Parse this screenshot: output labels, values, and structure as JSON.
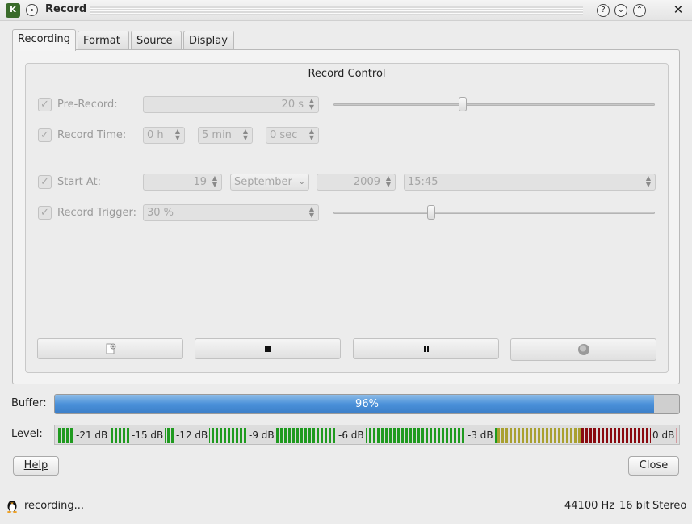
{
  "window": {
    "title": "Record",
    "app_icon": "kwave-icon"
  },
  "tabs": [
    {
      "label": "Recording",
      "mnemonic": "R"
    },
    {
      "label": "Format",
      "mnemonic": "m"
    },
    {
      "label": "Source",
      "mnemonic": "S"
    },
    {
      "label": "Display",
      "mnemonic": "D"
    }
  ],
  "record_control": {
    "title": "Record Control",
    "pre_record": {
      "label": "Pre-Record:",
      "value": "20 s",
      "slider_fraction": 0.4
    },
    "record_time": {
      "label": "Record Time:",
      "hours": "0 h",
      "minutes": "5 min",
      "seconds": "0 sec"
    },
    "start_at": {
      "label": "Start At:",
      "day": "19",
      "month": "September",
      "year": "2009",
      "time": "15:45"
    },
    "record_trigger": {
      "label": "Record Trigger:",
      "value": "30 %",
      "slider_fraction": 0.3
    }
  },
  "buffer": {
    "label": "Buffer:",
    "percent": 96,
    "text": "96%"
  },
  "level": {
    "label": "Level:",
    "ticks": [
      "-21 dB",
      "-15 dB",
      "-12 dB",
      "-9 dB",
      "-6 dB",
      "-3 dB",
      "0 dB"
    ]
  },
  "buttons": {
    "help": "Help",
    "close": "Close"
  },
  "status": {
    "state": "recording...",
    "rate": "44100 Hz",
    "bits": "16 bit",
    "channels": "Stereo"
  },
  "colors": {
    "buffer_fill": "#4a90d9",
    "meter_green": "#1f9a1f",
    "meter_yellow": "#a9a030",
    "meter_red": "#8a0a10"
  }
}
